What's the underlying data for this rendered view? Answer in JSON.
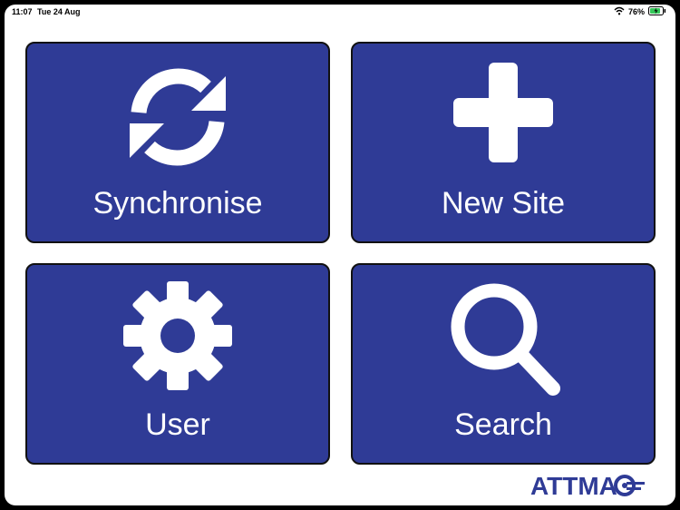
{
  "status_bar": {
    "time": "11:07",
    "date": "Tue 24 Aug",
    "battery": "76%"
  },
  "tiles": [
    {
      "label": "Synchronise",
      "icon": "sync-icon"
    },
    {
      "label": "New Site",
      "icon": "plus-icon"
    },
    {
      "label": "User",
      "icon": "gear-icon"
    },
    {
      "label": "Search",
      "icon": "search-icon"
    }
  ],
  "logo": {
    "text": "ATTMA"
  },
  "colors": {
    "tile_bg": "#2f3b96",
    "logo": "#2f3b96",
    "battery": "#35c759"
  }
}
